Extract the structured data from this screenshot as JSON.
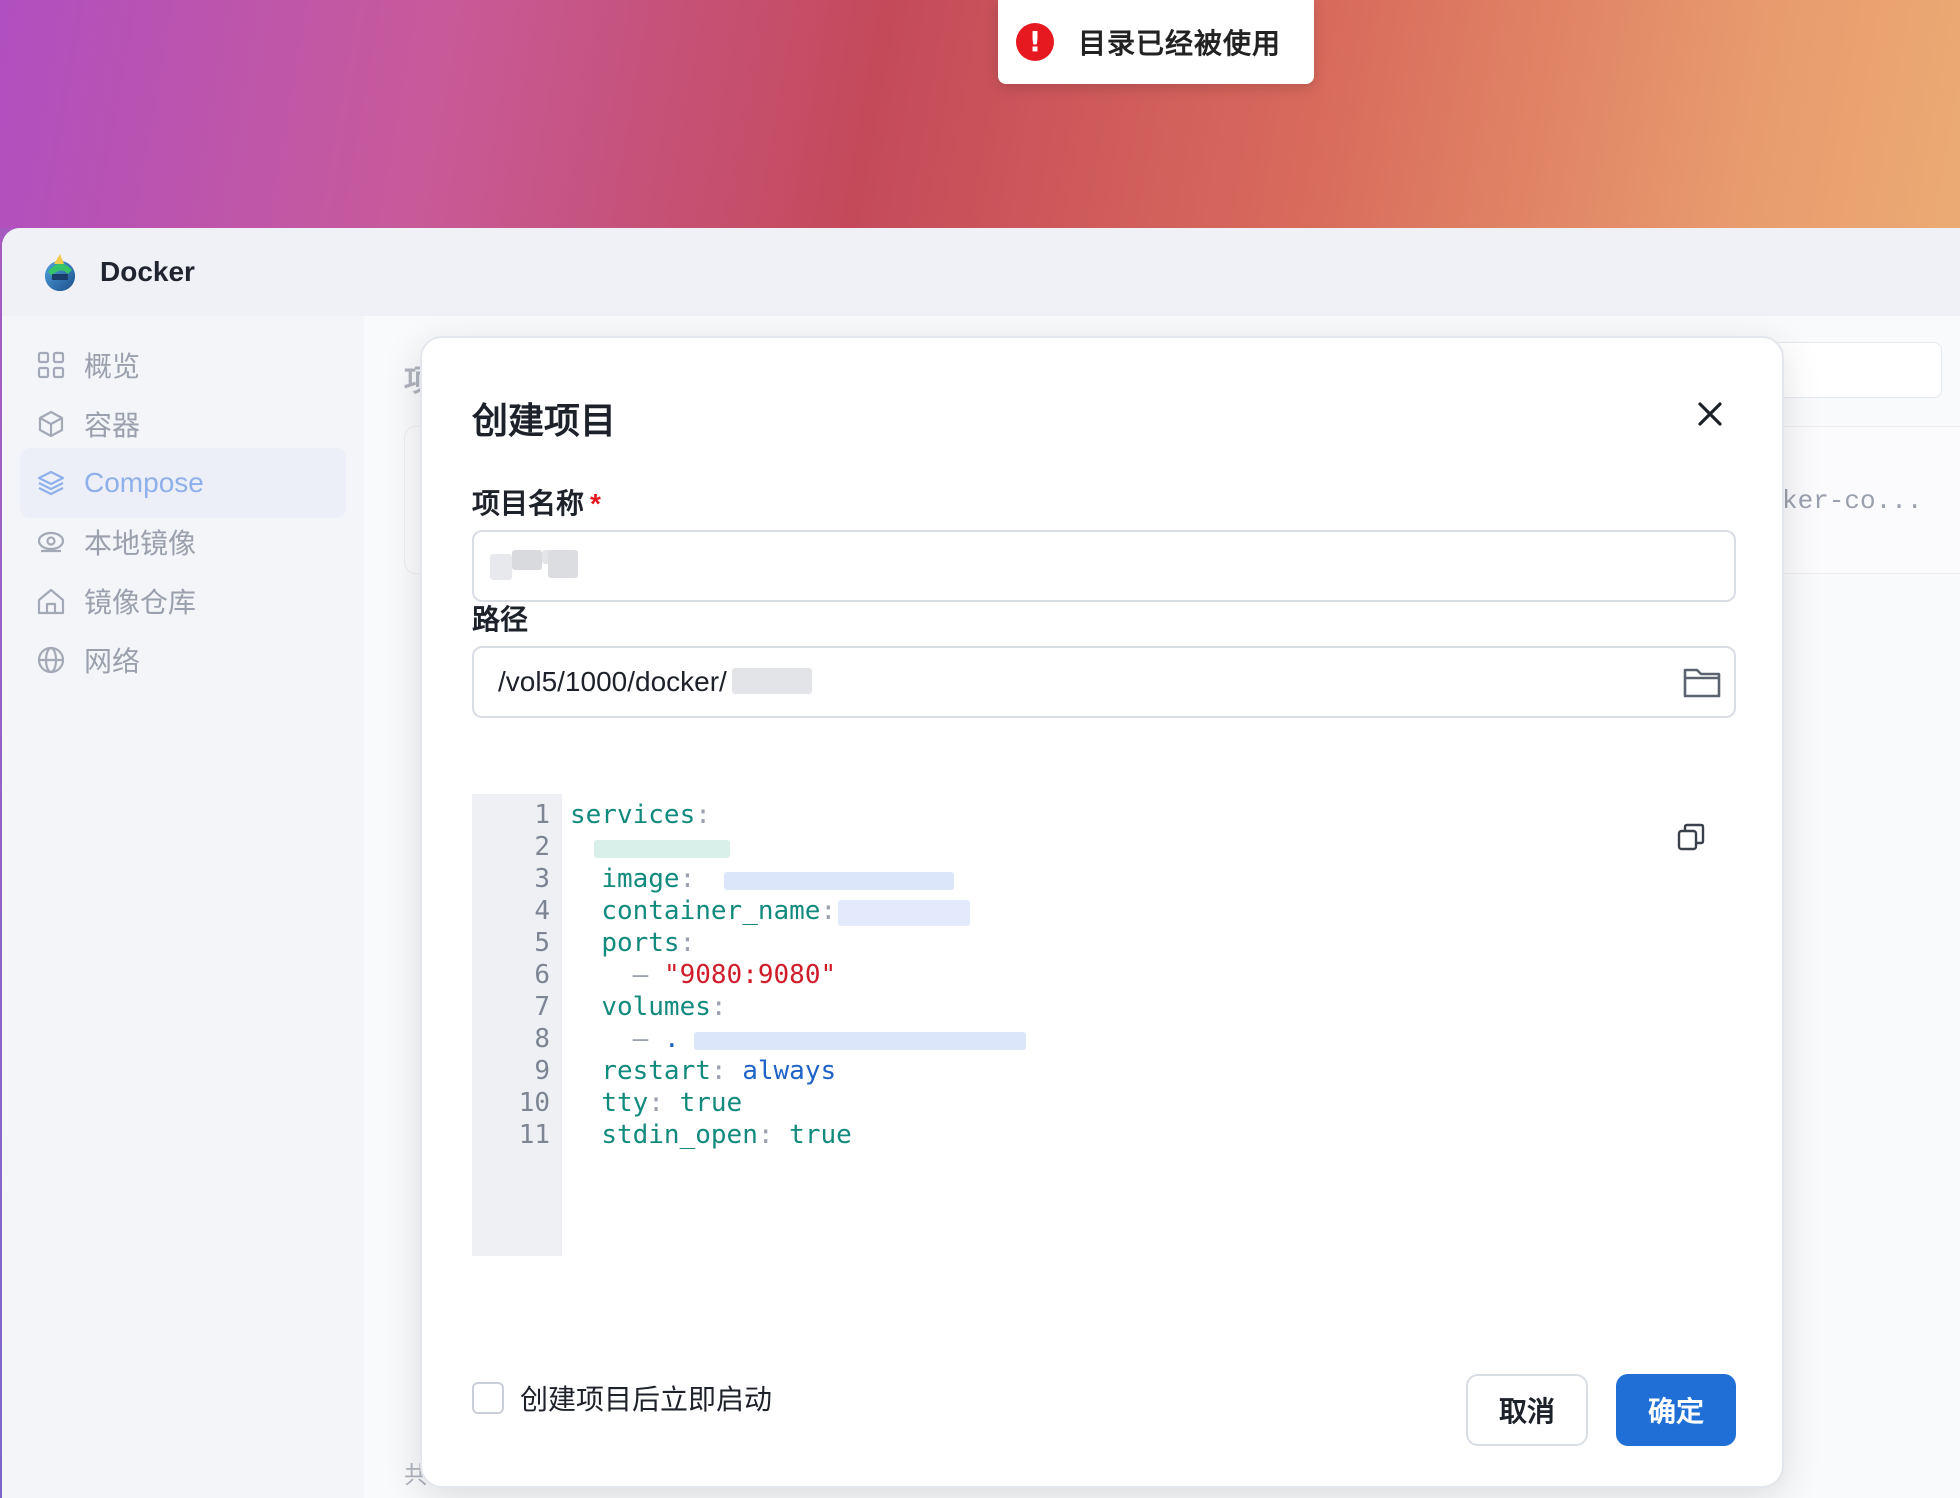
{
  "toast": {
    "icon": "error-icon",
    "message": "目录已经被使用"
  },
  "app": {
    "title": "Docker"
  },
  "sidebar": {
    "items": [
      {
        "label": "概览",
        "icon": "grid-icon"
      },
      {
        "label": "容器",
        "icon": "box-icon"
      },
      {
        "label": "Compose",
        "icon": "layers-icon",
        "active": true
      },
      {
        "label": "本地镜像",
        "icon": "disc-icon"
      },
      {
        "label": "镜像仓库",
        "icon": "home-icon"
      },
      {
        "label": "网络",
        "icon": "globe-icon"
      }
    ]
  },
  "main": {
    "title_partial": "项",
    "row_text_partial": "ker-co...",
    "footer_partial": "共"
  },
  "modal": {
    "title": "创建项目",
    "name_label": "项目名称",
    "required_mark": "*",
    "name_value": "",
    "path_label": "路径",
    "path_value": "/vol5/1000/docker/",
    "code": {
      "line_numbers": [
        "1",
        "2",
        "3",
        "4",
        "5",
        "6",
        "7",
        "8",
        "9",
        "10",
        "11"
      ],
      "lines": [
        {
          "key": "services",
          "colon": ":"
        },
        {
          "key": "",
          "colon": ""
        },
        {
          "key": "image",
          "colon": ":"
        },
        {
          "key": "container_name",
          "colon": ":"
        },
        {
          "key": "ports",
          "colon": ":"
        },
        {
          "dash": "–",
          "string": "\"9080:9080\""
        },
        {
          "key": "volumes",
          "colon": ":"
        },
        {
          "dash": "–",
          "plain": "."
        },
        {
          "key": "restart",
          "colon": ":",
          "value": "always"
        },
        {
          "key": "tty",
          "colon": ":",
          "value": "true"
        },
        {
          "key": "stdin_open",
          "colon": ":",
          "value": "true"
        }
      ]
    },
    "checkbox_label": "创建项目后立即启动",
    "cancel_label": "取消",
    "confirm_label": "确定"
  },
  "colors": {
    "accent": "#1f6fd6",
    "error": "#e5191f",
    "yaml_key": "#138a7e",
    "yaml_string": "#d01c2a",
    "yaml_value": "#1f63c8"
  }
}
